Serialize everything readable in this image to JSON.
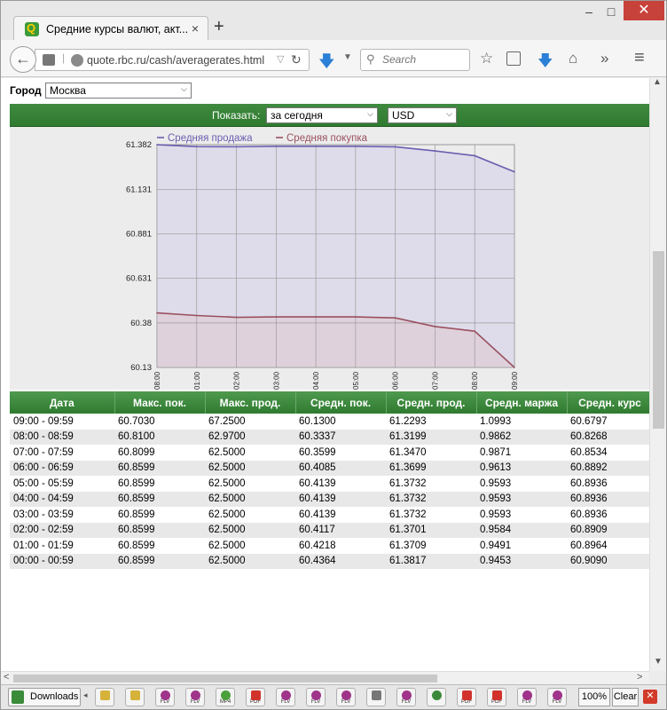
{
  "browser": {
    "tab_title": "Средние курсы валют, акт...",
    "tab_close": "×",
    "new_tab": "+",
    "url_host": "quote.rbc.ru",
    "url_path": "/cash/averagerates.html",
    "search_placeholder": "Search",
    "window_controls": {
      "minimize": "–",
      "maximize": "□",
      "close": "✕"
    },
    "icons": {
      "back": "back-arrow-icon",
      "downloads": "download-arrow-icon",
      "bookmark": "star-icon",
      "reading_list": "clipboard-icon",
      "home": "home-icon",
      "overflow": "chevron-double-right-icon",
      "menu": "hamburger-menu-icon"
    }
  },
  "page": {
    "city_label": "Город",
    "city_value": "Москва",
    "show_label": "Показать:",
    "period_value": "за сегодня",
    "currency_value": "USD",
    "accent_green": "#2f7a30"
  },
  "chart_data": {
    "type": "area",
    "x": [
      "08:00",
      "01:00",
      "02:00",
      "03:00",
      "04:00",
      "05:00",
      "06:00",
      "07:00",
      "08:00",
      "09:00"
    ],
    "y_ticks": [
      61.382,
      61.131,
      60.881,
      60.631,
      60.38,
      60.13
    ],
    "ylim": [
      60.13,
      61.382
    ],
    "series": [
      {
        "name": "Средняя продажа",
        "color": "#6a5fb0",
        "fill": "#dcd9ea",
        "values": [
          61.3817,
          61.3709,
          61.3701,
          61.3732,
          61.3732,
          61.3732,
          61.3699,
          61.347,
          61.3199,
          61.2293
        ]
      },
      {
        "name": "Средняя покупка",
        "color": "#9a5060",
        "fill": "#dfcfd8",
        "values": [
          60.4364,
          60.4218,
          60.4117,
          60.4139,
          60.4139,
          60.4139,
          60.4085,
          60.3599,
          60.3337,
          60.13
        ]
      }
    ],
    "grid": true,
    "legend": "top-left"
  },
  "table": {
    "headers": [
      "Дата",
      "Макс. пок.",
      "Макс. прод.",
      "Средн. пок.",
      "Средн. прод.",
      "Средн. маржа",
      "Средн. курс"
    ],
    "rows": [
      [
        "09:00 - 09:59",
        "60.7030",
        "67.2500",
        "60.1300",
        "61.2293",
        "1.0993",
        "60.6797"
      ],
      [
        "08:00 - 08:59",
        "60.8100",
        "62.9700",
        "60.3337",
        "61.3199",
        "0.9862",
        "60.8268"
      ],
      [
        "07:00 - 07:59",
        "60.8099",
        "62.5000",
        "60.3599",
        "61.3470",
        "0.9871",
        "60.8534"
      ],
      [
        "06:00 - 06:59",
        "60.8599",
        "62.5000",
        "60.4085",
        "61.3699",
        "0.9613",
        "60.8892"
      ],
      [
        "05:00 - 05:59",
        "60.8599",
        "62.5000",
        "60.4139",
        "61.3732",
        "0.9593",
        "60.8936"
      ],
      [
        "04:00 - 04:59",
        "60.8599",
        "62.5000",
        "60.4139",
        "61.3732",
        "0.9593",
        "60.8936"
      ],
      [
        "03:00 - 03:59",
        "60.8599",
        "62.5000",
        "60.4139",
        "61.3732",
        "0.9593",
        "60.8936"
      ],
      [
        "02:00 - 02:59",
        "60.8599",
        "62.5000",
        "60.4117",
        "61.3701",
        "0.9584",
        "60.8909"
      ],
      [
        "01:00 - 01:59",
        "60.8599",
        "62.5000",
        "60.4218",
        "61.3709",
        "0.9491",
        "60.8964"
      ],
      [
        "00:00 - 00:59",
        "60.8599",
        "62.5000",
        "60.4364",
        "61.3817",
        "0.9453",
        "60.9090"
      ]
    ]
  },
  "downloads_bar": {
    "downloads_label": "Downloads",
    "items": [
      {
        "icon": "lock",
        "label": ""
      },
      {
        "icon": "lock",
        "label": ""
      },
      {
        "icon": "flv",
        "label": "FLV"
      },
      {
        "icon": "flv",
        "label": "FLV"
      },
      {
        "icon": "mp4",
        "label": "MP4"
      },
      {
        "icon": "pdf",
        "label": "PDF"
      },
      {
        "icon": "flv",
        "label": "FLV"
      },
      {
        "icon": "flv",
        "label": "FLV"
      },
      {
        "icon": "flv",
        "label": "FLV"
      },
      {
        "icon": "doc",
        "label": ""
      },
      {
        "icon": "flv",
        "label": "FLV"
      },
      {
        "icon": "exe",
        "label": ""
      },
      {
        "icon": "pdf",
        "label": "PDF"
      },
      {
        "icon": "pdf",
        "label": "PDF"
      },
      {
        "icon": "flv",
        "label": "FLV"
      },
      {
        "icon": "flv",
        "label": "FLV"
      }
    ],
    "zoom": "100%",
    "clear_label": "Clear",
    "close_label": "✕"
  }
}
